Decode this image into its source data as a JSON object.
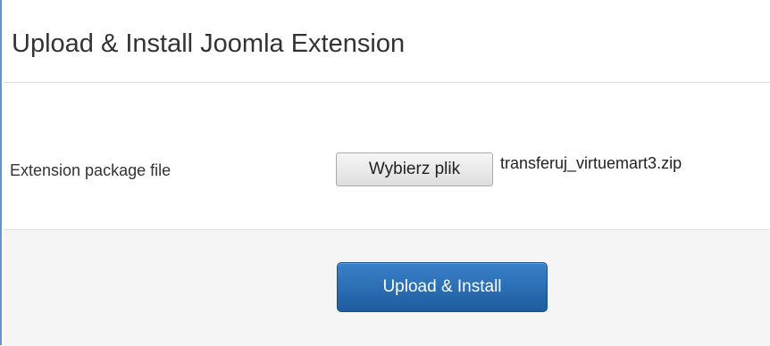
{
  "header": {
    "title": "Upload & Install Joomla Extension"
  },
  "form": {
    "package_label": "Extension package file",
    "choose_file_label": "Wybierz plik",
    "selected_file": "transferuj_virtuemart3.zip"
  },
  "actions": {
    "submit_label": "Upload & Install"
  },
  "colors": {
    "accent_border": "#6a93c8",
    "primary_button": "#2b6eb5",
    "footer_bg": "#f5f5f5"
  }
}
